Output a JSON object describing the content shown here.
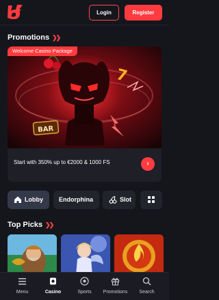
{
  "header": {
    "logo_icon": "bolt-logo-icon",
    "login_label": "Login",
    "register_label": "Register"
  },
  "promotions": {
    "title": "Promotions",
    "card": {
      "badge": "Welcome Casino Package",
      "text": "Start with 350% up to €2000 & 1000 FS",
      "go_icon": "chevron-right-icon",
      "image_text": "BAR"
    }
  },
  "tabs": [
    {
      "label": "Lobby",
      "icon": "home-icon",
      "active": true
    },
    {
      "label": "Endorphina",
      "icon": "",
      "active": false
    },
    {
      "label": "Slot",
      "icon": "cherry-icon",
      "active": false
    },
    {
      "label": "",
      "icon": "grid-icon",
      "active": false
    }
  ],
  "top_picks": {
    "title": "Top Picks",
    "games": [
      "fisherman-game-thumbnail",
      "fairy-game-thumbnail",
      "flame-game-thumbnail"
    ]
  },
  "bottom_nav": [
    {
      "label": "Menu",
      "icon": "menu-icon",
      "active": false
    },
    {
      "label": "Casino",
      "icon": "casino-chip-icon",
      "active": true
    },
    {
      "label": "Sports",
      "icon": "soccer-ball-icon",
      "active": false
    },
    {
      "label": "Promotions",
      "icon": "gift-icon",
      "active": false
    },
    {
      "label": "Search",
      "icon": "search-icon",
      "active": false
    }
  ],
  "colors": {
    "background": "#15161c",
    "accent": "#ff3b3f",
    "surface": "#1e1f27"
  }
}
